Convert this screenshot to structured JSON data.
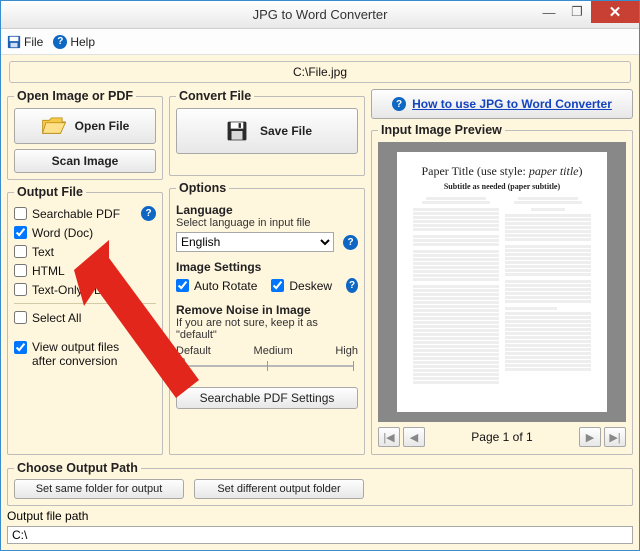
{
  "window": {
    "title": "JPG to Word Converter"
  },
  "menu": {
    "file": "File",
    "help": "Help"
  },
  "filepath": "C:\\File.jpg",
  "open_box": {
    "legend": "Open Image or PDF",
    "open_file": "Open File",
    "scan_image": "Scan Image"
  },
  "convert_box": {
    "legend": "Convert File",
    "save_file": "Save File"
  },
  "output_box": {
    "legend": "Output File",
    "items": [
      {
        "label": "Searchable PDF",
        "checked": false
      },
      {
        "label": "Word (Doc)",
        "checked": true
      },
      {
        "label": "Text",
        "checked": false
      },
      {
        "label": "HTML",
        "checked": false
      },
      {
        "label": "Text-Only PDF",
        "checked": false
      }
    ],
    "select_all": "Select All",
    "view_after": "View output files\nafter conversion",
    "view_after_checked": true
  },
  "options_box": {
    "legend": "Options",
    "language_head": "Language",
    "language_sub": "Select language in input file",
    "language_value": "English",
    "image_settings_head": "Image Settings",
    "auto_rotate": "Auto Rotate",
    "auto_rotate_checked": true,
    "deskew": "Deskew",
    "deskew_checked": true,
    "remove_noise_head": "Remove Noise in Image",
    "remove_noise_sub": "If you are not sure, keep it as \"default\"",
    "slider_labels": [
      "Default",
      "Medium",
      "High"
    ],
    "searchable_pdf_settings": "Searchable PDF Settings"
  },
  "howto": "How to use JPG to Word Converter",
  "preview": {
    "legend": "Input Image Preview",
    "paper_title_a": "Paper Title (use style: ",
    "paper_title_b": "paper title",
    "paper_title_c": ")",
    "paper_sub": "Subtitle as needed (paper subtitle)",
    "pager_first": "|◀",
    "pager_prev": "◀",
    "page_label": "Page 1 of 1",
    "pager_next": "▶",
    "pager_last": "▶|"
  },
  "choose_path": {
    "legend": "Choose Output Path",
    "same_btn": "Set same folder for output",
    "diff_btn": "Set different output folder"
  },
  "outpath": {
    "label": "Output file path",
    "value": "C:\\"
  }
}
